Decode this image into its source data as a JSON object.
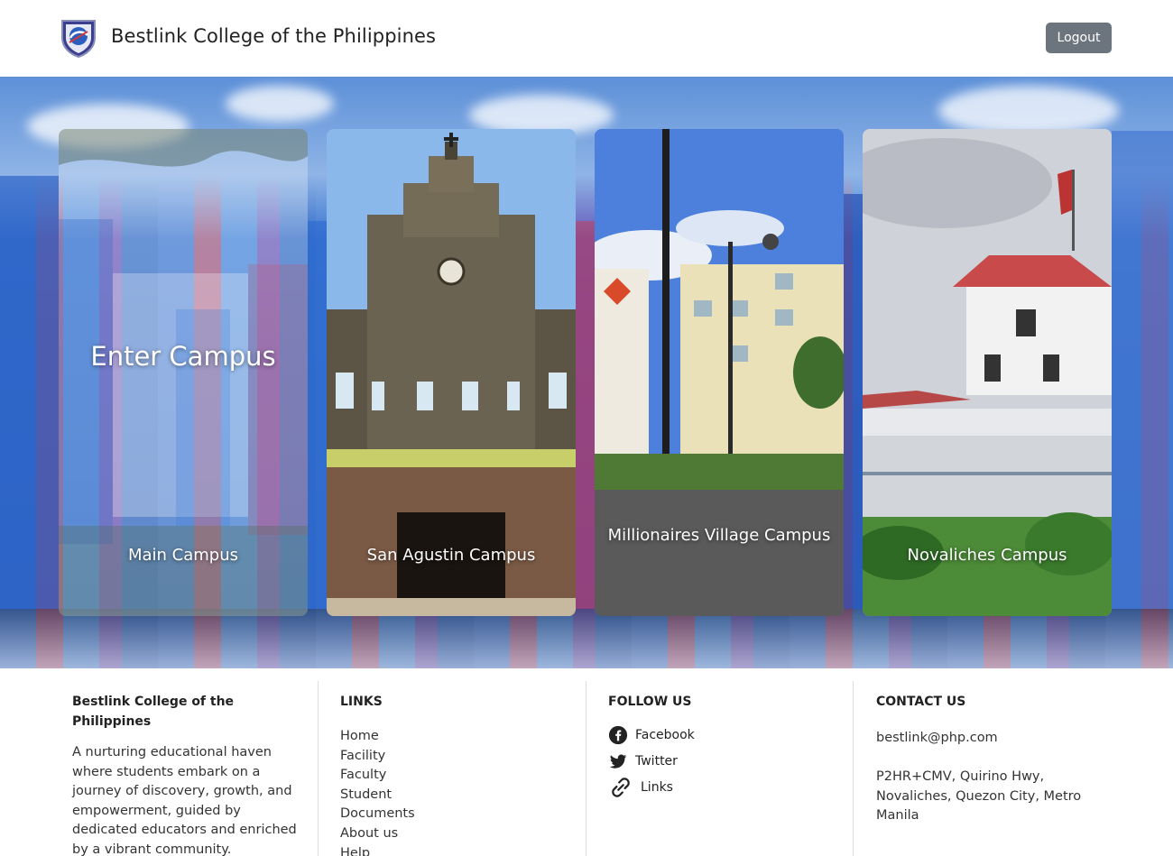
{
  "header": {
    "brand": "Bestlink College of the Philippines",
    "logout_label": "Logout"
  },
  "hero": {
    "enter_label": "Enter Campus",
    "cards": [
      {
        "label": "Main Campus"
      },
      {
        "label": "San Agustin Campus"
      },
      {
        "label": "Millionaires Village Campus"
      },
      {
        "label": "Novaliches Campus"
      }
    ]
  },
  "footer": {
    "about": {
      "title": "Bestlink College of the Philippines",
      "text": "A nurturing educational haven where students embark on a journey of discovery, growth, and empowerment, guided by dedicated educators and enriched by a vibrant community."
    },
    "links": {
      "title": "LINKS",
      "items": [
        "Home",
        "Facility",
        "Faculty",
        "Student",
        "Documents",
        "About us",
        "Help"
      ]
    },
    "follow": {
      "title": "FOLLOW US",
      "items": [
        {
          "label": "Facebook",
          "icon": "facebook-icon"
        },
        {
          "label": "Twitter",
          "icon": "twitter-icon"
        },
        {
          "label": "Links",
          "icon": "link-icon"
        }
      ]
    },
    "contact": {
      "title": "CONTACT US",
      "email": "bestlink@php.com",
      "address": "P2HR+CMV, Quirino Hwy, Novaliches, Quezon City, Metro Manila"
    }
  },
  "colors": {
    "logout_bg": "#6c757d",
    "hero_blue": "#2d6fd0"
  }
}
